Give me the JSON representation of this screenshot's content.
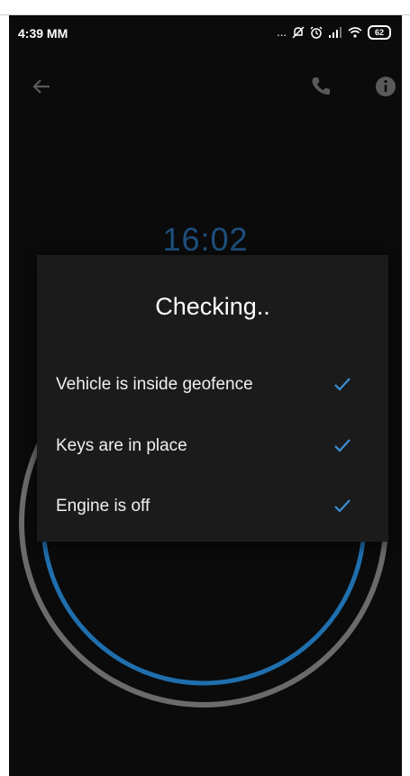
{
  "status_bar": {
    "time": "4:39 MM",
    "dots": "...",
    "battery": "62"
  },
  "app_bar": {
    "icons": [
      "back-arrow-icon",
      "phone-icon",
      "info-icon"
    ]
  },
  "timer": {
    "value": "16:02"
  },
  "dialog": {
    "title": "Checking..",
    "items": [
      {
        "label": "Vehicle is inside geofence",
        "status": "checked"
      },
      {
        "label": "Keys are in place",
        "status": "checked"
      },
      {
        "label": "Engine is off",
        "status": "checked"
      }
    ]
  },
  "colors": {
    "background": "#0b0b0b",
    "dialog": "#1b1b1b",
    "accent": "#3a8fd6",
    "timer": "#1e4f7c",
    "ring_outer": "#6b6b6b",
    "ring_inner": "#1f6fae"
  }
}
